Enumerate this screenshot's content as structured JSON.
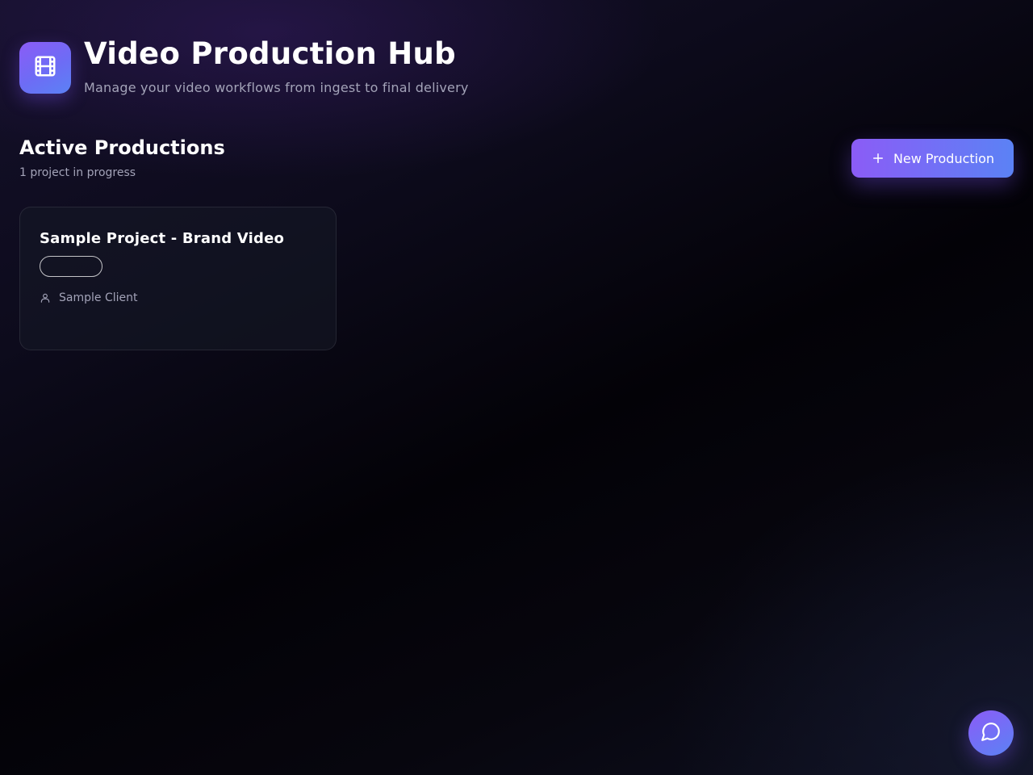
{
  "header": {
    "title": "Video Production Hub",
    "subtitle": "Manage your video workflows from ingest to final delivery",
    "logo_icon": "film-icon"
  },
  "section": {
    "title": "Active Productions",
    "count_text": "1 project in progress"
  },
  "actions": {
    "new_production_label": "New Production",
    "new_production_icon": "plus-icon"
  },
  "projects": [
    {
      "title": "Sample Project - Brand Video",
      "status": "",
      "client": "Sample Client",
      "client_icon": "user-icon"
    }
  ],
  "chat": {
    "icon": "message-circle-icon"
  },
  "colors": {
    "accent_start": "#8b5cf6",
    "accent_end": "#5b82f5",
    "muted_text": "#a3a3b8"
  }
}
